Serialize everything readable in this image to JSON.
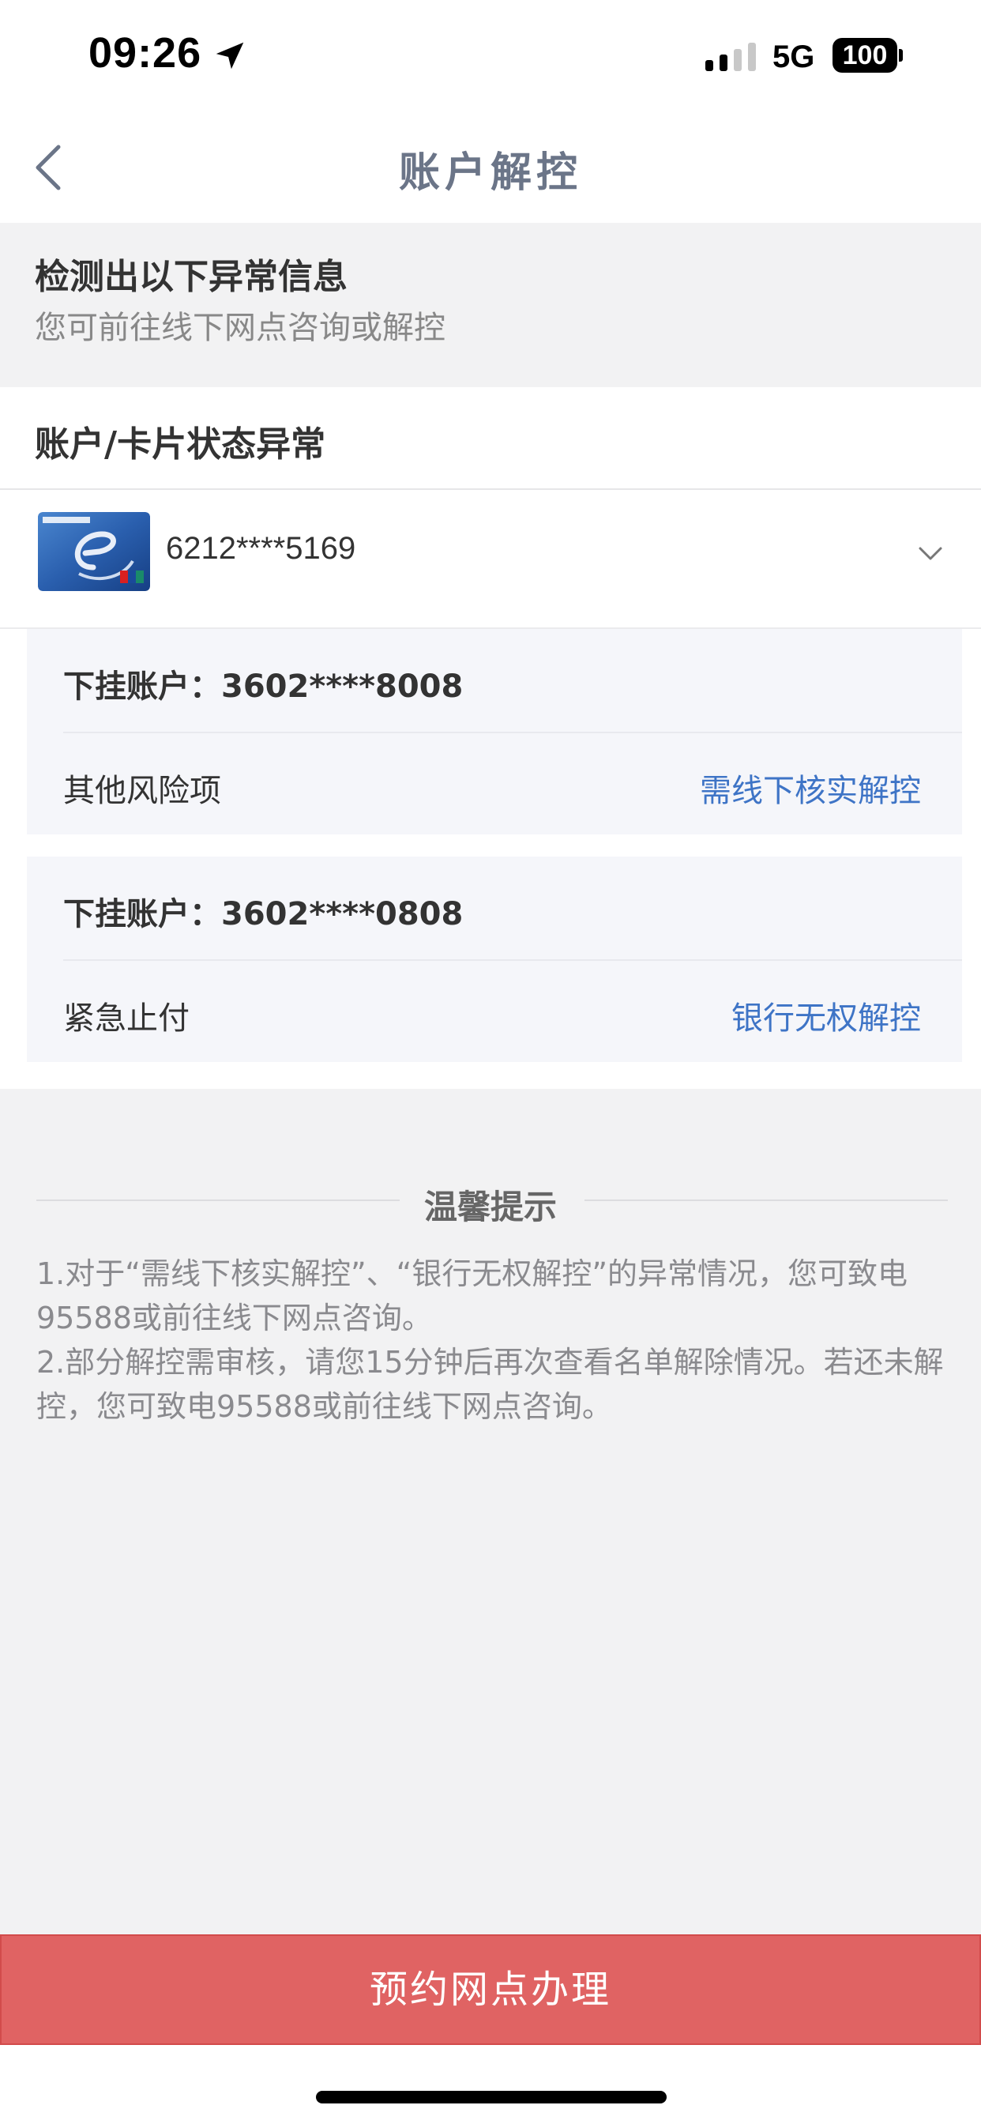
{
  "status_bar": {
    "time": "09:26",
    "network": "5G",
    "battery": "100",
    "icons": [
      "location-arrow-icon",
      "cellular-signal-icon",
      "battery-icon"
    ]
  },
  "nav": {
    "title": "账户解控",
    "back_icon": "chevron-left-icon"
  },
  "notice": {
    "title": "检测出以下异常信息",
    "subtitle": "您可前往线下网点咨询或解控"
  },
  "status_section": {
    "heading": "账户/卡片状态异常",
    "card": {
      "number": "6212****5169",
      "expand_icon": "chevron-down-icon"
    },
    "sub_accounts": [
      {
        "label": "下挂账户：3602****8008",
        "risk": "其他风险项",
        "action": "需线下核实解控"
      },
      {
        "label": "下挂账户：3602****0808",
        "risk": "紧急止付",
        "action": "银行无权解控"
      }
    ]
  },
  "tips": {
    "title": "温馨提示",
    "line1": "1.对于“需线下核实解控”、“银行无权解控”的异常情况，您可致电95588或前往线下网点咨询。",
    "line2": "2.部分解控需审核，请您15分钟后再次查看名单解除情况。若还未解控，您可致电95588或前往线下网点咨询。"
  },
  "actions": {
    "book_label": "预约网点办理"
  },
  "colors": {
    "accent_blue": "#3e74c6",
    "button_red": "#e06363",
    "title_gray": "#6b7588"
  }
}
